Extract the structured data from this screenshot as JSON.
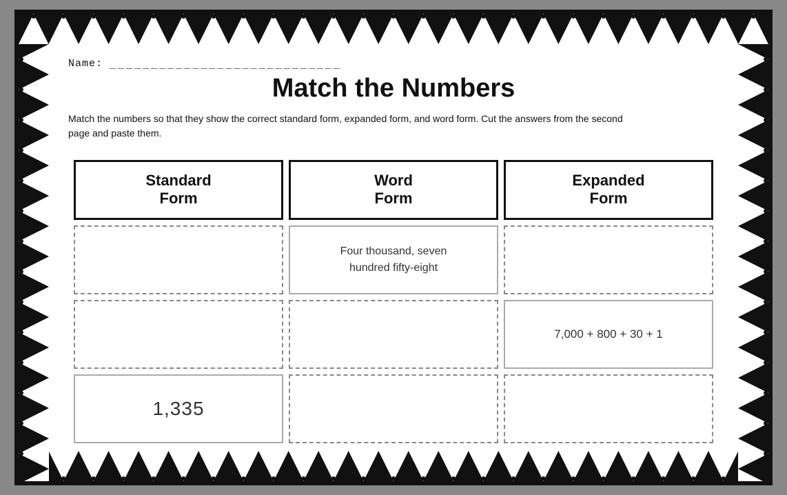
{
  "page": {
    "title": "Match the Numbers",
    "name_label": "Name:",
    "name_line": "____________________________",
    "instructions": "Match the numbers so that they show the correct standard form, expanded form, and word form. Cut the answers from the second page and paste them."
  },
  "table": {
    "headers": [
      "Standard\nForm",
      "Word\nForm",
      "Expanded\nForm"
    ],
    "header_labels": [
      "Standard Form",
      "Word Form",
      "Expanded Form"
    ],
    "rows": [
      {
        "standard": "",
        "word": "Four thousand, seven hundred fifty-eight",
        "expanded": ""
      },
      {
        "standard": "",
        "word": "",
        "expanded": "7,000 + 800 + 30 + 1"
      },
      {
        "standard": "1,335",
        "word": "",
        "expanded": ""
      }
    ]
  },
  "border": {
    "color": "#111",
    "bg": "#fff"
  }
}
